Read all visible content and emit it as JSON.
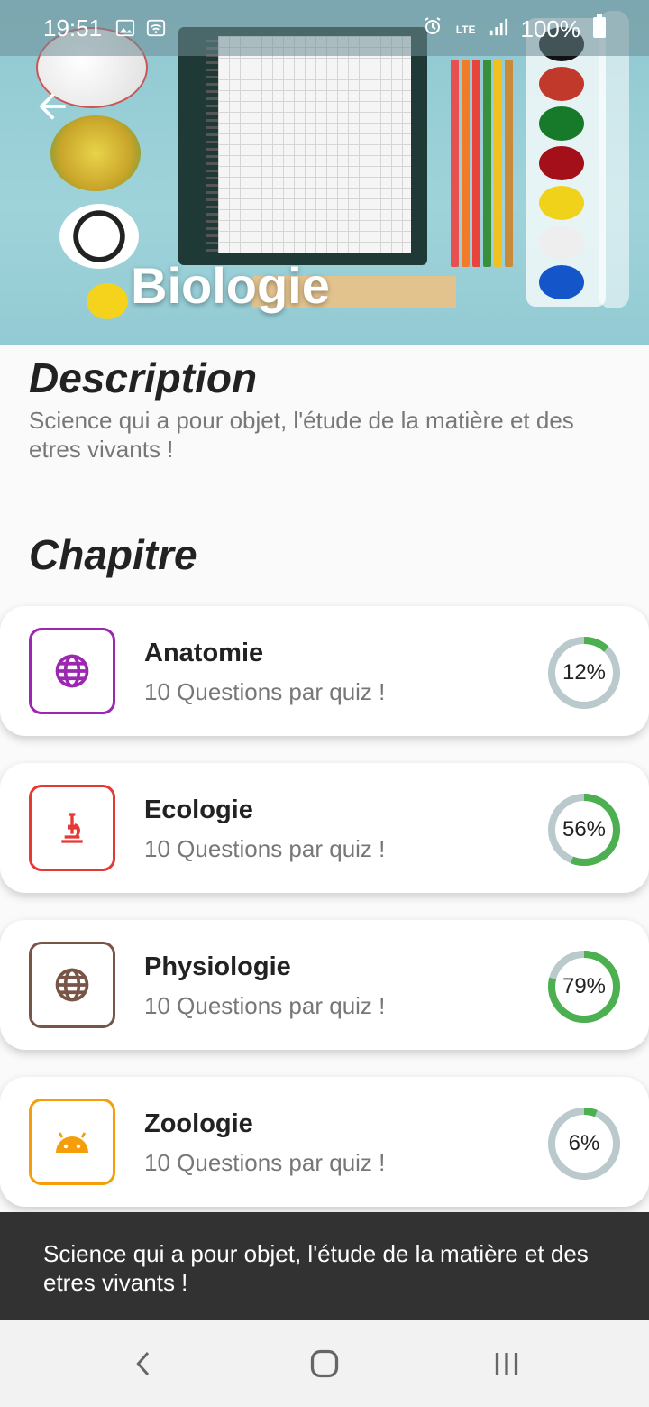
{
  "status_bar": {
    "time": "19:51",
    "network": "LTE",
    "battery": "100%"
  },
  "header": {
    "title": "Biologie",
    "back_icon": "arrow-left-icon"
  },
  "description": {
    "heading": "Description",
    "text": "Science qui a pour objet, l'étude de la matière et des etres vivants !"
  },
  "chapters": {
    "heading": "Chapitre",
    "items": [
      {
        "title": "Anatomie",
        "subtitle": "10 Questions par quiz !",
        "progress_label": "12%",
        "progress": 0.12,
        "icon": "globe-icon",
        "color": "#9c27b0"
      },
      {
        "title": "Ecologie",
        "subtitle": "10 Questions par quiz !",
        "progress_label": "56%",
        "progress": 0.56,
        "icon": "microscope-icon",
        "color": "#e53935"
      },
      {
        "title": "Physiologie",
        "subtitle": "10 Questions par quiz !",
        "progress_label": "79%",
        "progress": 0.79,
        "icon": "globe-icon",
        "color": "#795548"
      },
      {
        "title": "Zoologie",
        "subtitle": "10 Questions par quiz !",
        "progress_label": "6%",
        "progress": 0.06,
        "icon": "android-icon",
        "color": "#f59e0b"
      }
    ]
  },
  "snackbar": {
    "text": "Science qui a pour objet, l'étude de la matière et des etres vivants !"
  },
  "colors": {
    "progress_fill": "#4caf50",
    "progress_track": "#b9c9cc",
    "snackbar_bg": "#323232"
  },
  "nav": {
    "back_icon": "nav-back-icon",
    "home_icon": "nav-home-icon",
    "recents_icon": "nav-recents-icon"
  }
}
